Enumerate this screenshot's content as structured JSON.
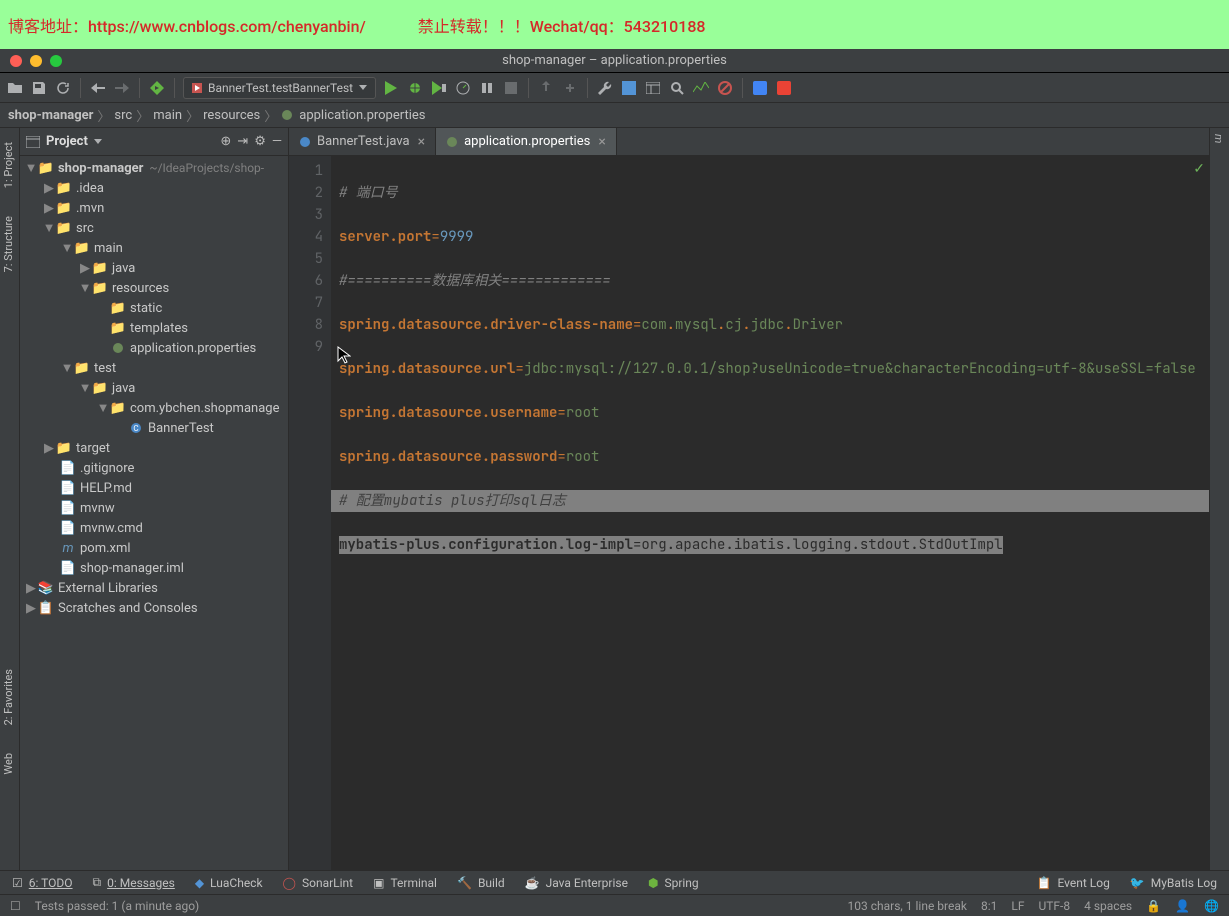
{
  "banner": {
    "blog": "博客地址：https://www.cnblogs.com/chenyanbin/",
    "warn": "禁止转载！！！Wechat/qq：543210188"
  },
  "window_title": "shop-manager – application.properties",
  "run_config": "BannerTest.testBannerTest",
  "breadcrumb": [
    "shop-manager",
    "src",
    "main",
    "resources",
    "application.properties"
  ],
  "panel_title": "Project",
  "tree": {
    "root": {
      "name": "shop-manager",
      "path": "~/IdeaProjects/shop-"
    },
    "idea": ".idea",
    "mvn": ".mvn",
    "src": "src",
    "main": "main",
    "java": "java",
    "resources": "resources",
    "static": "static",
    "templates": "templates",
    "appprops": "application.properties",
    "test": "test",
    "testjava": "java",
    "pkg": "com.ybchen.shopmanage",
    "bannertest": "BannerTest",
    "target": "target",
    "gitignore": ".gitignore",
    "help": "HELP.md",
    "mvnw": "mvnw",
    "mvnwcmd": "mvnw.cmd",
    "pom": "pom.xml",
    "iml": "shop-manager.iml",
    "ext": "External Libraries",
    "scratch": "Scratches and Consoles"
  },
  "tabs": [
    {
      "label": "BannerTest.java",
      "active": false
    },
    {
      "label": "application.properties",
      "active": true
    }
  ],
  "code": {
    "l1": "# 端口号",
    "l2k": "server.port",
    "l2v": "9999",
    "l3": "#==========数据库相关=============",
    "l4k": "spring.datasource.driver-class-name",
    "l4v1": "com",
    "l4v2": "mysql",
    "l4v3": "cj",
    "l4v4": "jdbc",
    "l4v5": "Driver",
    "l5k": "spring.datasource.url",
    "l5v": "jdbc:mysql://127.0.0.1/shop?useUnicode=true&characterEncoding=utf-8&useSSL=false",
    "l6k": "spring.datasource.username",
    "l6v": "root",
    "l7k": "spring.datasource.password",
    "l7v": "root",
    "l8": "# 配置mybatis plus打印sql日志",
    "l9k": "mybatis-plus.configuration.log-impl",
    "l9v1": "org",
    "l9v2": "apache",
    "l9v3": "ibatis",
    "l9v4": "logging",
    "l9v5": "stdout",
    "l9v6": "StdOutImpl"
  },
  "bottom": {
    "todo": "6: TODO",
    "messages": "0: Messages",
    "luacheck": "LuaCheck",
    "sonarlint": "SonarLint",
    "terminal": "Terminal",
    "build": "Build",
    "javaee": "Java Enterprise",
    "spring": "Spring",
    "eventlog": "Event Log",
    "mybatislog": "MyBatis Log"
  },
  "status": {
    "tests": "Tests passed: 1 (a minute ago)",
    "chars": "103 chars, 1 line break",
    "pos": "8:1",
    "lf": "LF",
    "enc": "UTF-8",
    "indent": "4 spaces"
  },
  "side": {
    "project": "1: Project",
    "structure": "7: Structure",
    "favorites": "2: Favorites",
    "web": "Web"
  }
}
